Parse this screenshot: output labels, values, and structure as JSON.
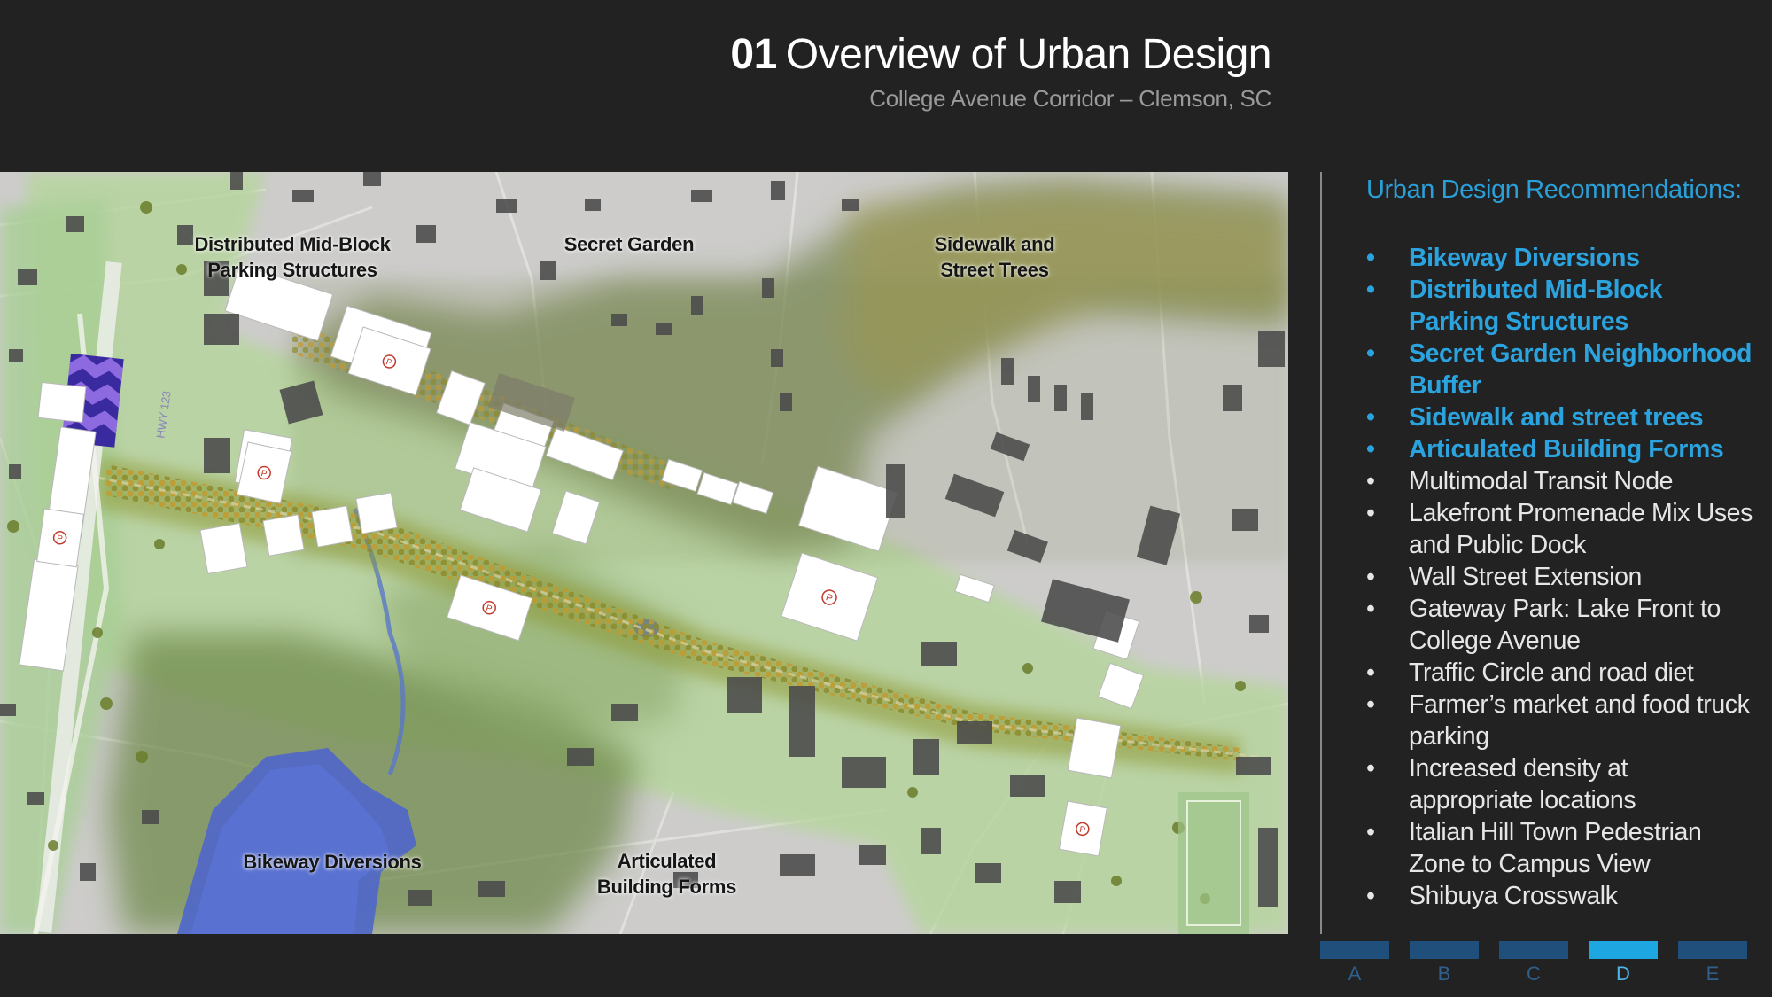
{
  "header": {
    "number": "01",
    "title": "Overview of Urban Design",
    "subtitle": "College Avenue Corridor – Clemson, SC"
  },
  "map": {
    "labels": {
      "parking": "Distributed Mid-Block\nParking Structures",
      "garden": "Secret Garden",
      "sidewalk": "Sidewalk and\nStreet Trees",
      "bikeway": "Bikeway Diversions",
      "articulated": "Articulated\nBuilding Forms",
      "hwy": "HWY 123"
    },
    "colors": {
      "water": "#4f67c9",
      "vegetation": "#5e7a2b",
      "autumn": "#b08a2a",
      "green_space": "#a6c98a",
      "building_dark": "#4a4a4a",
      "parking_red": "#c0392b"
    }
  },
  "panel": {
    "heading": "Urban Design Recommendations:",
    "items": [
      {
        "text": "Bikeway Diversions",
        "highlight": true
      },
      {
        "text": "Distributed Mid-Block Parking Structures",
        "highlight": true
      },
      {
        "text": "Secret Garden Neighborhood Buffer",
        "highlight": true
      },
      {
        "text": "Sidewalk and street trees",
        "highlight": true
      },
      {
        "text": "Articulated Building Forms",
        "highlight": true
      },
      {
        "text": "Multimodal Transit Node",
        "highlight": false
      },
      {
        "text": "Lakefront Promenade Mix Uses and Public Dock",
        "highlight": false
      },
      {
        "text": "Wall Street Extension",
        "highlight": false
      },
      {
        "text": "Gateway Park: Lake Front  to College Avenue",
        "highlight": false
      },
      {
        "text": "Traffic Circle and road diet",
        "highlight": false
      },
      {
        "text": "Farmer’s market and food truck parking",
        "highlight": false
      },
      {
        "text": "Increased density at appropriate locations",
        "highlight": false
      },
      {
        "text": "Italian Hill Town Pedestrian Zone to Campus View",
        "highlight": false
      },
      {
        "text": "Shibuya Crosswalk",
        "highlight": false
      }
    ],
    "bullet": "•"
  },
  "nav": {
    "tabs": [
      {
        "label": "A",
        "active": false
      },
      {
        "label": "B",
        "active": false
      },
      {
        "label": "C",
        "active": false
      },
      {
        "label": "D",
        "active": true
      },
      {
        "label": "E",
        "active": false
      }
    ],
    "colors": {
      "inactive": "#1f4f7a",
      "active": "#1ea6e0"
    }
  }
}
